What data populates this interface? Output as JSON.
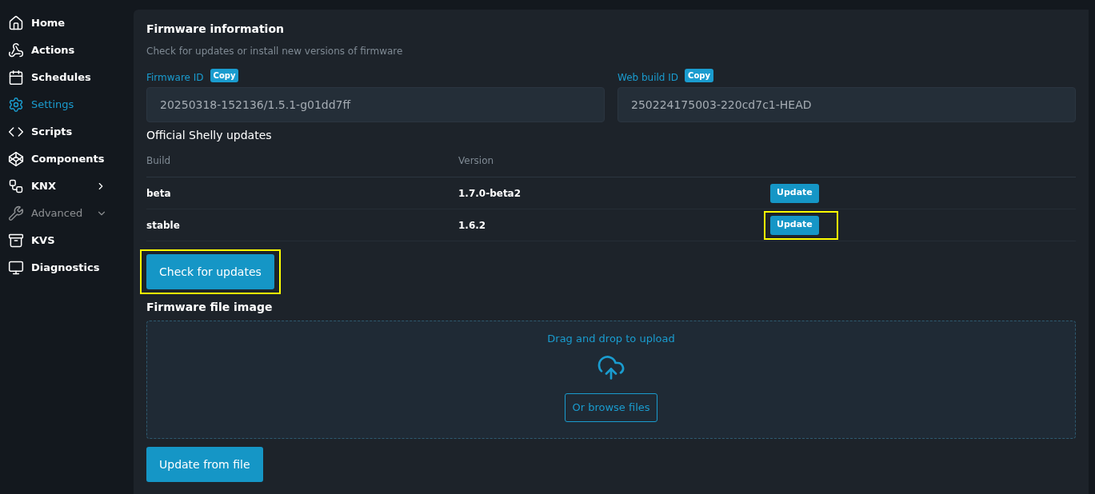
{
  "sidebar": {
    "items": [
      {
        "label": "Home",
        "kind": "link",
        "selected": false,
        "disabled": false
      },
      {
        "label": "Actions",
        "kind": "link",
        "selected": false,
        "disabled": false
      },
      {
        "label": "Schedules",
        "kind": "link",
        "selected": false,
        "disabled": false
      },
      {
        "label": "Settings",
        "kind": "link",
        "selected": true,
        "disabled": false
      },
      {
        "label": "Scripts",
        "kind": "link",
        "selected": false,
        "disabled": false
      },
      {
        "label": "Components",
        "kind": "link",
        "selected": false,
        "disabled": false
      },
      {
        "label": "KNX",
        "kind": "group",
        "selected": false,
        "disabled": false,
        "expanded": false
      },
      {
        "label": "Advanced",
        "kind": "group",
        "selected": false,
        "disabled": true,
        "expanded": true
      },
      {
        "label": "KVS",
        "kind": "link",
        "selected": false,
        "disabled": false
      },
      {
        "label": "Diagnostics",
        "kind": "link",
        "selected": false,
        "disabled": false
      }
    ]
  },
  "firmware": {
    "title": "Firmware information",
    "subtitle": "Check for updates or install new versions of firmware",
    "fields": [
      {
        "label": "Firmware ID",
        "copy": "Copy",
        "value": "20250318-152136/1.5.1-g01dd7ff"
      },
      {
        "label": "Web build ID",
        "copy": "Copy",
        "value": "250224175003-220cd7c1-HEAD"
      }
    ],
    "updates": {
      "title": "Official Shelly updates",
      "columns": [
        "Build",
        "Version"
      ],
      "rows": [
        {
          "build": "beta",
          "version": "1.7.0-beta2",
          "button": "Update",
          "highlighted": false
        },
        {
          "build": "stable",
          "version": "1.6.2",
          "button": "Update",
          "highlighted": true
        }
      ]
    },
    "check_button": {
      "label": "Check for updates",
      "highlighted": true
    },
    "file": {
      "title": "Firmware file image",
      "drop_text": "Drag and drop to upload",
      "browse": "Or browse files",
      "submit": "Update from file"
    }
  }
}
